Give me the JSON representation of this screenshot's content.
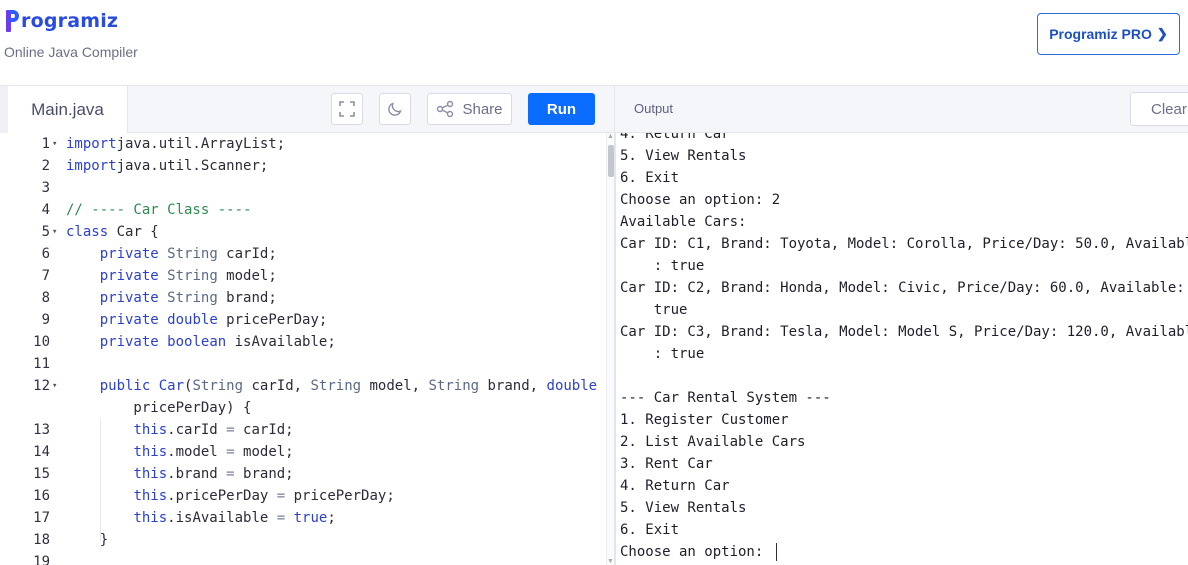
{
  "brand": {
    "logo_text": "rogramiz",
    "subtitle": "Online Java Compiler"
  },
  "header": {
    "pro_button": "Programiz PRO"
  },
  "toolbar": {
    "file_tab": "Main.java",
    "share_label": "Share",
    "run_label": "Run",
    "output_label": "Output",
    "clear_label": "Clear"
  },
  "editor": {
    "lines": [
      {
        "n": "1",
        "fold": true,
        "tokens": [
          [
            "kw",
            "import"
          ],
          [
            "",
            "java.util.ArrayList;"
          ]
        ]
      },
      {
        "n": "2",
        "fold": false,
        "tokens": [
          [
            "kw",
            "import"
          ],
          [
            "",
            "java.util.Scanner;"
          ]
        ]
      },
      {
        "n": "3",
        "fold": false,
        "tokens": []
      },
      {
        "n": "4",
        "fold": false,
        "tokens": [
          [
            "cm",
            "// ---- Car Class ----"
          ]
        ]
      },
      {
        "n": "5",
        "fold": true,
        "tokens": [
          [
            "kw",
            "class"
          ],
          [
            "",
            " Car {"
          ]
        ]
      },
      {
        "n": "6",
        "fold": false,
        "tokens": [
          [
            "",
            "    "
          ],
          [
            "kw",
            "private"
          ],
          [
            "",
            " "
          ],
          [
            "ty",
            "String"
          ],
          [
            "",
            " carId;"
          ]
        ]
      },
      {
        "n": "7",
        "fold": false,
        "tokens": [
          [
            "",
            "    "
          ],
          [
            "kw",
            "private"
          ],
          [
            "",
            " "
          ],
          [
            "ty",
            "String"
          ],
          [
            "",
            " model;"
          ]
        ]
      },
      {
        "n": "8",
        "fold": false,
        "tokens": [
          [
            "",
            "    "
          ],
          [
            "kw",
            "private"
          ],
          [
            "",
            " "
          ],
          [
            "ty",
            "String"
          ],
          [
            "",
            " brand;"
          ]
        ]
      },
      {
        "n": "9",
        "fold": false,
        "tokens": [
          [
            "",
            "    "
          ],
          [
            "kw",
            "private"
          ],
          [
            "",
            " "
          ],
          [
            "kw",
            "double"
          ],
          [
            "",
            " pricePerDay;"
          ]
        ]
      },
      {
        "n": "10",
        "fold": false,
        "tokens": [
          [
            "",
            "    "
          ],
          [
            "kw",
            "private"
          ],
          [
            "",
            " "
          ],
          [
            "kw",
            "boolean"
          ],
          [
            "",
            " isAvailable;"
          ]
        ]
      },
      {
        "n": "11",
        "fold": false,
        "tokens": []
      },
      {
        "n": "12",
        "fold": true,
        "tokens": [
          [
            "",
            "    "
          ],
          [
            "kw",
            "public"
          ],
          [
            "",
            " "
          ],
          [
            "kw",
            "Car"
          ],
          [
            "",
            "("
          ],
          [
            "ty",
            "String"
          ],
          [
            "",
            " carId, "
          ],
          [
            "ty",
            "String"
          ],
          [
            "",
            " model, "
          ],
          [
            "ty",
            "String"
          ],
          [
            "",
            " brand, "
          ],
          [
            "kw",
            "double"
          ]
        ]
      },
      {
        "n": "",
        "fold": false,
        "tokens": [
          [
            "",
            "        pricePerDay) {"
          ]
        ]
      },
      {
        "n": "13",
        "fold": false,
        "tokens": [
          [
            "",
            "        "
          ],
          [
            "kw",
            "this"
          ],
          [
            "",
            ".carId "
          ],
          [
            "op",
            "="
          ],
          [
            "",
            " carId;"
          ]
        ]
      },
      {
        "n": "14",
        "fold": false,
        "tokens": [
          [
            "",
            "        "
          ],
          [
            "kw",
            "this"
          ],
          [
            "",
            ".model "
          ],
          [
            "op",
            "="
          ],
          [
            "",
            " model;"
          ]
        ]
      },
      {
        "n": "15",
        "fold": false,
        "tokens": [
          [
            "",
            "        "
          ],
          [
            "kw",
            "this"
          ],
          [
            "",
            ".brand "
          ],
          [
            "op",
            "="
          ],
          [
            "",
            " brand;"
          ]
        ]
      },
      {
        "n": "16",
        "fold": false,
        "tokens": [
          [
            "",
            "        "
          ],
          [
            "kw",
            "this"
          ],
          [
            "",
            ".pricePerDay "
          ],
          [
            "op",
            "="
          ],
          [
            "",
            " pricePerDay;"
          ]
        ]
      },
      {
        "n": "17",
        "fold": false,
        "tokens": [
          [
            "",
            "        "
          ],
          [
            "kw",
            "this"
          ],
          [
            "",
            ".isAvailable "
          ],
          [
            "op",
            "="
          ],
          [
            "",
            " "
          ],
          [
            "kw",
            "true"
          ],
          [
            "",
            ";"
          ]
        ]
      },
      {
        "n": "18",
        "fold": false,
        "tokens": [
          [
            "",
            "    }"
          ]
        ]
      },
      {
        "n": "19",
        "fold": false,
        "tokens": []
      }
    ]
  },
  "output": {
    "lines": [
      "4. Return Car",
      "5. View Rentals",
      "6. Exit",
      "Choose an option: 2",
      "Available Cars:",
      "Car ID: C1, Brand: Toyota, Model: Corolla, Price/Day: 50.0, Availabl",
      "    : true",
      "Car ID: C2, Brand: Honda, Model: Civic, Price/Day: 60.0, Available:",
      "    true",
      "Car ID: C3, Brand: Tesla, Model: Model S, Price/Day: 120.0, Availabl",
      "    : true",
      "",
      "--- Car Rental System ---",
      "1. Register Customer",
      "2. List Available Cars",
      "3. Rent Car",
      "4. Return Car",
      "5. View Rentals",
      "6. Exit",
      "Choose an option: "
    ]
  }
}
